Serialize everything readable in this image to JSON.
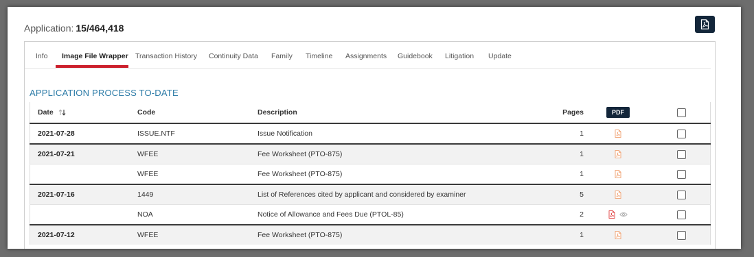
{
  "application": {
    "label": "Application:",
    "number": "15/464,418"
  },
  "tabs": [
    {
      "label": "Info"
    },
    {
      "label": "Image File Wrapper",
      "active": true
    },
    {
      "label": "Transaction History"
    },
    {
      "label": "Continuity Data"
    },
    {
      "label": "Family"
    },
    {
      "label": "Timeline"
    },
    {
      "label": "Assignments"
    },
    {
      "label": "Guidebook"
    },
    {
      "label": "Litigation"
    },
    {
      "label": "Update"
    }
  ],
  "section_title": "APPLICATION PROCESS TO-DATE",
  "table": {
    "headers": {
      "date": "Date",
      "code": "Code",
      "description": "Description",
      "pages": "Pages",
      "pdf": "PDF"
    },
    "rows": [
      {
        "date": "2021-07-28",
        "code": "ISSUE.NTF",
        "description": "Issue Notification",
        "pages": "1",
        "icon": "pdf-file-icon",
        "preview": false
      },
      {
        "date": "2021-07-21",
        "code": "WFEE",
        "description": "Fee Worksheet (PTO-875)",
        "pages": "1",
        "icon": "pdf-file-icon",
        "preview": false
      },
      {
        "date": "",
        "code": "WFEE",
        "description": "Fee Worksheet (PTO-875)",
        "pages": "1",
        "icon": "pdf-file-icon",
        "preview": false
      },
      {
        "date": "2021-07-16",
        "code": "1449",
        "description": "List of References cited by applicant and considered by examiner",
        "pages": "5",
        "icon": "pdf-file-icon",
        "preview": false
      },
      {
        "date": "",
        "code": "NOA",
        "description": "Notice of Allowance and Fees Due (PTOL-85)",
        "pages": "2",
        "icon": "pdf-file-icon",
        "preview": true
      },
      {
        "date": "2021-07-12",
        "code": "WFEE",
        "description": "Fee Worksheet (PTO-875)",
        "pages": "1",
        "icon": "pdf-file-icon",
        "preview": false
      }
    ]
  },
  "colors": {
    "accent_red": "#cc1f2c",
    "section_blue": "#2c7ba7",
    "navy": "#13263a",
    "pdf_orange": "#f0a070"
  }
}
